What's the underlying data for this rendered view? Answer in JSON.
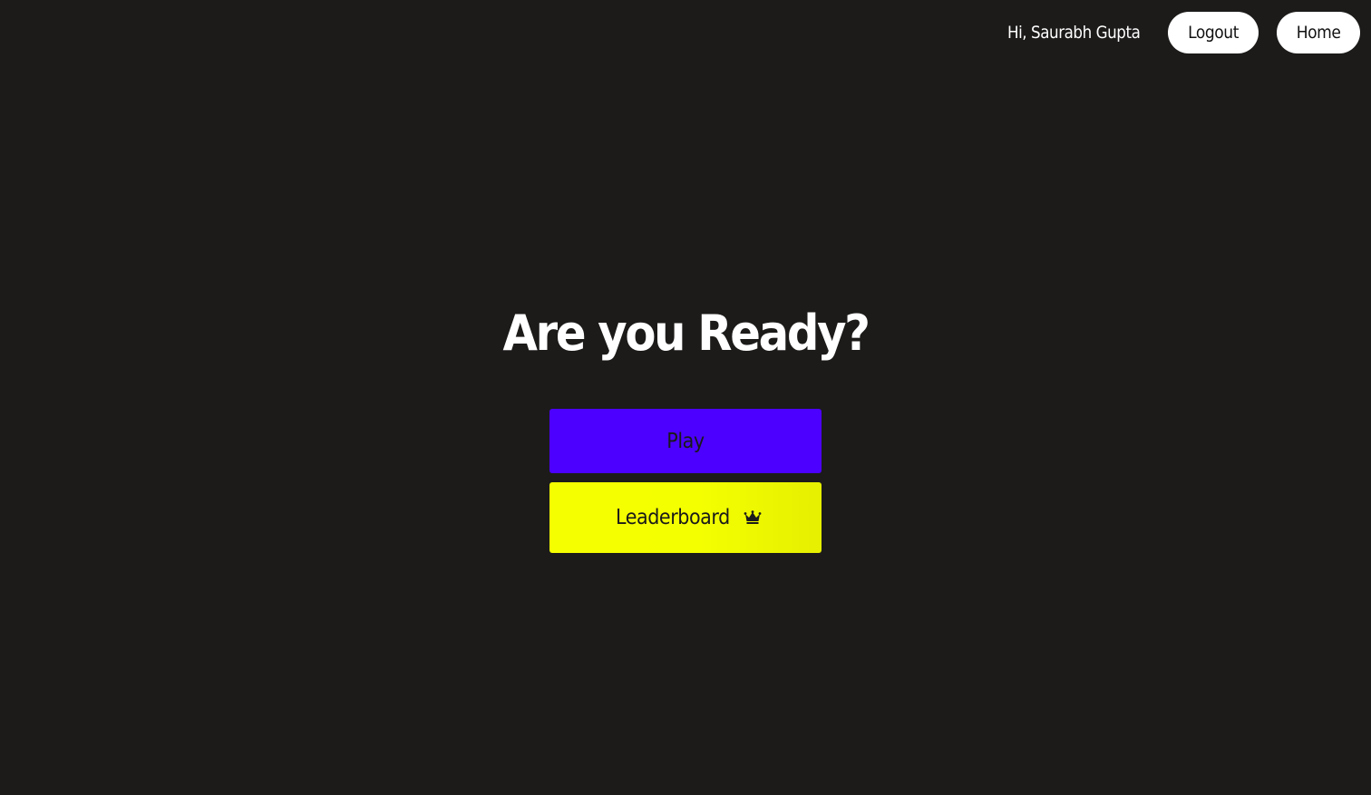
{
  "header": {
    "greeting": "Hi, Saurabh Gupta",
    "logout_label": "Logout",
    "home_label": "Home"
  },
  "main": {
    "headline": "Are you Ready?",
    "play_label": "Play",
    "leaderboard_label": "Leaderboard",
    "leaderboard_icon": "crown-icon"
  },
  "colors": {
    "background": "#1c1b1a",
    "play_button": "#4c00ff",
    "leaderboard_button": "#f4ff00",
    "pill_button": "#ffffff"
  }
}
